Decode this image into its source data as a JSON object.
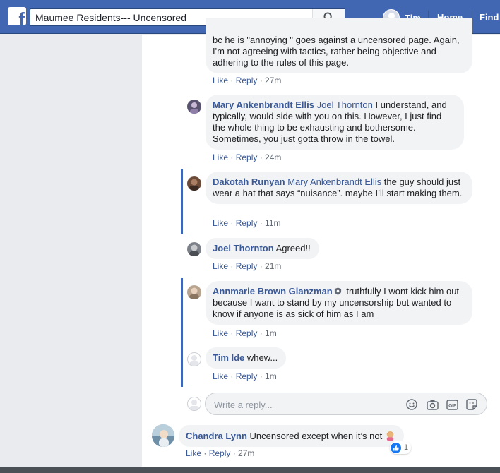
{
  "header": {
    "search_value": "Maumee Residents--- Uncensored",
    "user_name": "Tim",
    "nav_home": "Home",
    "nav_find": "Find"
  },
  "comments": [
    {
      "text": "bc he is \"annoying \" goes against a uncensored page. Again, I'm not agreeing with tactics, rather being objective and adhering to the rules of this page.",
      "like": "Like",
      "reply": "Reply",
      "time": "27m"
    },
    {
      "author": "Mary Ankenbrandt Ellis",
      "tag": "Joel Thornton",
      "text": " I understand, and typically, would side with you on this. However, I just find the whole thing to be exhausting and bothersome. Sometimes, you just gotta throw in the towel.",
      "like": "Like",
      "reply": "Reply",
      "time": "24m"
    },
    {
      "author": "Dakotah Runyan",
      "tag": "Mary Ankenbrandt Ellis",
      "text": " the guy should just wear a hat that says “nuisance”. maybe I’ll start making them.",
      "like": "Like",
      "reply": "Reply",
      "time": "11m"
    },
    {
      "author": "Joel Thornton",
      "text": " Agreed!!",
      "like": "Like",
      "reply": "Reply",
      "time": "21m"
    },
    {
      "author": "Annmarie Brown Glanzman",
      "text": " truthfully I wont kick him out because I want to stand by my uncensorship but wanted to know if anyone is as sick of him as I am",
      "like": "Like",
      "reply": "Reply",
      "time": "1m"
    },
    {
      "author": "Tim Ide",
      "text": " whew...",
      "like": "Like",
      "reply": "Reply",
      "time": "1m"
    },
    {
      "author": "Chandra Lynn",
      "text": " Uncensored except when it’s not ",
      "like": "Like",
      "reply": "Reply",
      "time": "27m",
      "reaction_count": "1"
    }
  ],
  "reply_box": {
    "placeholder": "Write a reply...",
    "icons": [
      "smiley-icon",
      "camera-icon",
      "gif-icon",
      "sticker-icon"
    ]
  },
  "sep": " · ",
  "colors": {
    "brand": "#4267b2",
    "link": "#385898",
    "bubble": "#f2f3f5"
  }
}
